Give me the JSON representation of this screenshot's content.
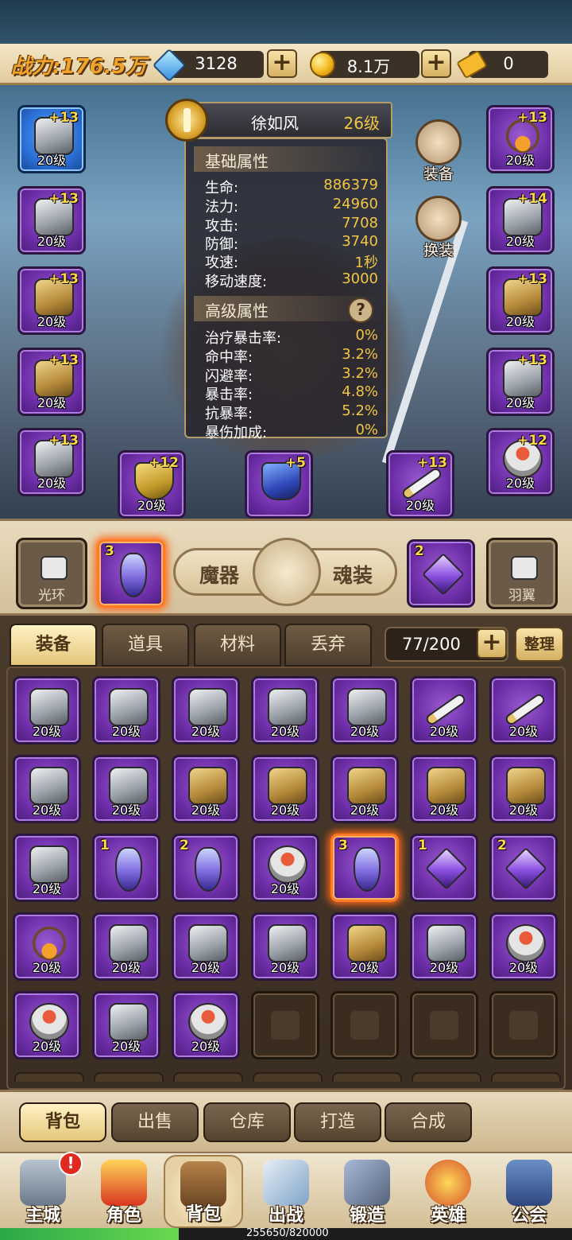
{
  "resources": {
    "power_label": "战力:176.5万",
    "gems": "3128",
    "gold": "8.1万",
    "tickets": "0",
    "plus": "+"
  },
  "hero": {
    "name": "徐如风",
    "level": "26级",
    "basic_title": "基础属性",
    "basic": [
      {
        "k": "生命:",
        "v": "886379"
      },
      {
        "k": "法力:",
        "v": "24960"
      },
      {
        "k": "攻击:",
        "v": "7708"
      },
      {
        "k": "防御:",
        "v": "3740"
      },
      {
        "k": "攻速:",
        "v": "1秒"
      },
      {
        "k": "移动速度:",
        "v": "3000"
      }
    ],
    "adv_title": "高级属性",
    "help": "?",
    "advanced": [
      {
        "k": "治疗暴击率:",
        "v": "0%"
      },
      {
        "k": "命中率:",
        "v": "3.2%"
      },
      {
        "k": "闪避率:",
        "v": "3.2%"
      },
      {
        "k": "暴击率:",
        "v": "4.8%"
      },
      {
        "k": "抗暴率:",
        "v": "5.2%"
      },
      {
        "k": "暴伤加成:",
        "v": "0%"
      }
    ]
  },
  "actions": {
    "equip": "装备",
    "swap": "换装"
  },
  "equipped_left": [
    {
      "plus": "+13",
      "lv": "20级",
      "icon": "helmet-icon"
    },
    {
      "plus": "+13",
      "lv": "20级",
      "icon": "chest-armor-icon"
    },
    {
      "plus": "+13",
      "lv": "20级",
      "icon": "belt-icon"
    },
    {
      "plus": "+13",
      "lv": "20级",
      "icon": "pants-icon"
    },
    {
      "plus": "+13",
      "lv": "20级",
      "icon": "boots-icon"
    }
  ],
  "equipped_right": [
    {
      "plus": "+13",
      "lv": "20级",
      "icon": "necklace-icon"
    },
    {
      "plus": "+14",
      "lv": "20级",
      "icon": "shoulder-icon"
    },
    {
      "plus": "+13",
      "lv": "20级",
      "icon": "bracer-icon"
    },
    {
      "plus": "+13",
      "lv": "20级",
      "icon": "gauntlet-icon"
    },
    {
      "plus": "+12",
      "lv": "20级",
      "icon": "ring-icon"
    }
  ],
  "equipped_bottom": [
    {
      "plus": "+12",
      "lv": "20级",
      "icon": "shield-icon"
    },
    {
      "plus": "+5",
      "lv": "",
      "icon": "trophy-icon"
    },
    {
      "plus": "+13",
      "lv": "20级",
      "icon": "sword-icon"
    }
  ],
  "magic": {
    "left_locked": "光环",
    "right_locked": "羽翼",
    "label_left": "魔器",
    "label_right": "魂装",
    "left_slot_num": "3",
    "right_slot_num": "2"
  },
  "inventory": {
    "tabs": [
      "装备",
      "道具",
      "材料",
      "丢弃"
    ],
    "capacity": "77/200",
    "sort": "整理",
    "items": [
      {
        "lv": "20级",
        "icon": "boots-icon"
      },
      {
        "lv": "20级",
        "icon": "boots-icon"
      },
      {
        "lv": "20级",
        "icon": "boots-icon"
      },
      {
        "lv": "20级",
        "icon": "boots-icon"
      },
      {
        "lv": "20级",
        "icon": "boots-icon"
      },
      {
        "lv": "20级",
        "icon": "sword-icon"
      },
      {
        "lv": "20级",
        "icon": "sword-icon"
      },
      {
        "lv": "20级",
        "icon": "chest-armor-icon"
      },
      {
        "lv": "20级",
        "icon": "chest-armor-icon"
      },
      {
        "lv": "20级",
        "icon": "belt-icon"
      },
      {
        "lv": "20级",
        "icon": "belt-icon"
      },
      {
        "lv": "20级",
        "icon": "pants-icon"
      },
      {
        "lv": "20级",
        "icon": "pants-icon"
      },
      {
        "lv": "20级",
        "icon": "pants-icon"
      },
      {
        "lv": "20级",
        "icon": "boots-icon"
      },
      {
        "num": "1",
        "icon": "amulet-icon"
      },
      {
        "num": "2",
        "icon": "amulet-icon"
      },
      {
        "lv": "20级",
        "icon": "ring-icon"
      },
      {
        "num": "3",
        "icon": "amulet-icon",
        "glow": true
      },
      {
        "num": "1",
        "icon": "gem-icon"
      },
      {
        "num": "2",
        "icon": "gem-icon"
      },
      {
        "lv": "20级",
        "icon": "necklace-icon"
      },
      {
        "lv": "20级",
        "icon": "shoulder-icon"
      },
      {
        "lv": "20级",
        "icon": "shoulder-icon"
      },
      {
        "lv": "20级",
        "icon": "shoulder-icon"
      },
      {
        "lv": "20级",
        "icon": "bracer-icon"
      },
      {
        "lv": "20级",
        "icon": "gauntlet-icon"
      },
      {
        "lv": "20级",
        "icon": "ring-icon"
      },
      {
        "lv": "20级",
        "icon": "ring-icon"
      },
      {
        "lv": "20级",
        "icon": "boots-icon"
      },
      {
        "lv": "20级",
        "icon": "ring-icon"
      },
      {
        "empty": true
      },
      {
        "empty": true
      },
      {
        "empty": true
      },
      {
        "empty": true
      }
    ]
  },
  "bottom_tabs": [
    "背包",
    "出售",
    "仓库",
    "打造",
    "合成"
  ],
  "nav": [
    {
      "label": "主城",
      "icon": "castle-icon"
    },
    {
      "label": "角色",
      "icon": "crown-icon"
    },
    {
      "label": "背包",
      "icon": "backpack-icon"
    },
    {
      "label": "出战",
      "icon": "crossed-swords-icon"
    },
    {
      "label": "锻造",
      "icon": "hammer-icon"
    },
    {
      "label": "英雄",
      "icon": "fist-badge-icon"
    },
    {
      "label": "公会",
      "icon": "guild-helmet-icon"
    }
  ],
  "nav_alert": "!",
  "xp": {
    "text": "255650/820000",
    "fraction": 0.312
  },
  "colors": {
    "epic": "#6d2ea8",
    "rare": "#2b6fd6",
    "gold_text": "#f2c544",
    "power": "#f2a32a"
  }
}
